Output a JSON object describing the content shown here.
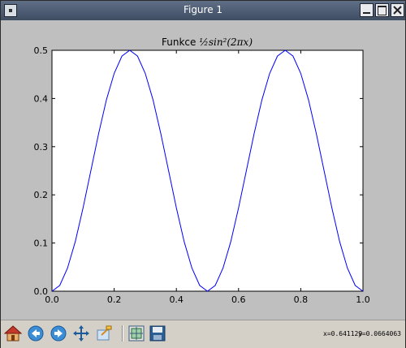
{
  "window": {
    "title": "Figure 1"
  },
  "toolbar": {
    "buttons": [
      {
        "name": "home-icon",
        "label": "Home"
      },
      {
        "name": "back-icon",
        "label": "Back"
      },
      {
        "name": "forward-icon",
        "label": "Forward"
      },
      {
        "name": "pan-icon",
        "label": "Pan"
      },
      {
        "name": "zoom-icon",
        "label": "Zoom"
      },
      {
        "name": "subplots-icon",
        "label": "Subplots"
      },
      {
        "name": "save-icon",
        "label": "Save"
      }
    ],
    "x_readout": "x=0.641129",
    "y_readout": "y=0.0664063"
  },
  "chart_data": {
    "type": "line",
    "title_prefix": "Funkce ",
    "title_math": "½sin²(2πx)",
    "xlim": [
      0.0,
      1.0
    ],
    "ylim": [
      0.0,
      0.5
    ],
    "x_ticks": [
      "0.0",
      "0.2",
      "0.4",
      "0.6",
      "0.8",
      "1.0"
    ],
    "y_ticks": [
      "0.0",
      "0.1",
      "0.2",
      "0.3",
      "0.4",
      "0.5"
    ],
    "series": [
      {
        "color": "#0000ff",
        "x": [
          0.0,
          0.025,
          0.05,
          0.075,
          0.1,
          0.125,
          0.15,
          0.175,
          0.2,
          0.225,
          0.25,
          0.275,
          0.3,
          0.325,
          0.35,
          0.375,
          0.4,
          0.425,
          0.45,
          0.475,
          0.5,
          0.525,
          0.55,
          0.575,
          0.6,
          0.625,
          0.65,
          0.675,
          0.7,
          0.725,
          0.75,
          0.775,
          0.8,
          0.825,
          0.85,
          0.875,
          0.9,
          0.925,
          0.95,
          0.975,
          1.0
        ],
        "y": [
          0.0,
          0.012,
          0.048,
          0.103,
          0.173,
          0.25,
          0.327,
          0.397,
          0.452,
          0.488,
          0.5,
          0.488,
          0.452,
          0.397,
          0.327,
          0.25,
          0.173,
          0.103,
          0.048,
          0.012,
          0.0,
          0.012,
          0.048,
          0.103,
          0.173,
          0.25,
          0.327,
          0.397,
          0.452,
          0.488,
          0.5,
          0.488,
          0.452,
          0.397,
          0.327,
          0.25,
          0.173,
          0.103,
          0.048,
          0.012,
          0.0
        ]
      }
    ]
  }
}
